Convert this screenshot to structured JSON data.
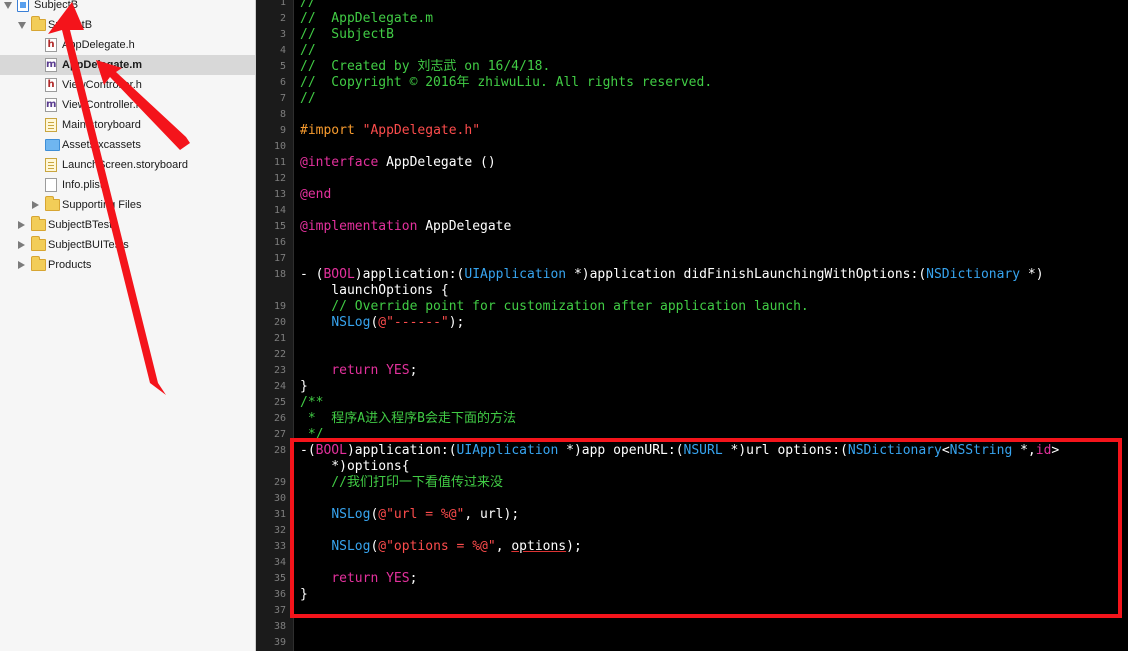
{
  "navigator": {
    "items": [
      {
        "label": "SubjectB",
        "kind": "project",
        "depth": 0,
        "disclosure": "open"
      },
      {
        "label": "SubjectB",
        "kind": "folder",
        "depth": 1,
        "disclosure": "open"
      },
      {
        "label": "AppDelegate.h",
        "kind": "h",
        "depth": 2,
        "disclosure": "none"
      },
      {
        "label": "AppDelegate.m",
        "kind": "m",
        "depth": 2,
        "disclosure": "none",
        "selected": true
      },
      {
        "label": "ViewController.h",
        "kind": "h",
        "depth": 2,
        "disclosure": "none"
      },
      {
        "label": "ViewController.m",
        "kind": "m",
        "depth": 2,
        "disclosure": "none"
      },
      {
        "label": "Main.storyboard",
        "kind": "storyboard",
        "depth": 2,
        "disclosure": "none"
      },
      {
        "label": "Assets.xcassets",
        "kind": "assets",
        "depth": 2,
        "disclosure": "none"
      },
      {
        "label": "LaunchScreen.storyboard",
        "kind": "storyboard",
        "depth": 2,
        "disclosure": "none"
      },
      {
        "label": "Info.plist",
        "kind": "plist",
        "depth": 2,
        "disclosure": "none"
      },
      {
        "label": "Supporting Files",
        "kind": "folder",
        "depth": 2,
        "disclosure": "closed"
      },
      {
        "label": "SubjectBTests",
        "kind": "folder",
        "depth": 1,
        "disclosure": "closed"
      },
      {
        "label": "SubjectBUITests",
        "kind": "folder",
        "depth": 1,
        "disclosure": "closed"
      },
      {
        "label": "Products",
        "kind": "folder",
        "depth": 1,
        "disclosure": "closed"
      }
    ]
  },
  "editor": {
    "lines": [
      {
        "n": "1",
        "tokens": [
          [
            "//",
            "cm"
          ]
        ]
      },
      {
        "n": "2",
        "tokens": [
          [
            "//  AppDelegate.m",
            "cm"
          ]
        ]
      },
      {
        "n": "3",
        "tokens": [
          [
            "//  SubjectB",
            "cm"
          ]
        ]
      },
      {
        "n": "4",
        "tokens": [
          [
            "//",
            "cm"
          ]
        ]
      },
      {
        "n": "5",
        "tokens": [
          [
            "//  Created by 刘志武 on 16/4/18.",
            "cm"
          ]
        ]
      },
      {
        "n": "6",
        "tokens": [
          [
            "//  Copyright © 2016年 zhiwuLiu. All rights reserved.",
            "cm"
          ]
        ]
      },
      {
        "n": "7",
        "tokens": [
          [
            "//",
            "cm"
          ]
        ]
      },
      {
        "n": "8",
        "tokens": []
      },
      {
        "n": "9",
        "tokens": [
          [
            "#import ",
            "pp"
          ],
          [
            "\"AppDelegate.h\"",
            "str"
          ]
        ]
      },
      {
        "n": "10",
        "tokens": []
      },
      {
        "n": "11",
        "tokens": [
          [
            "@interface",
            "kw"
          ],
          [
            " AppDelegate ()",
            "df"
          ]
        ]
      },
      {
        "n": "12",
        "tokens": []
      },
      {
        "n": "13",
        "tokens": [
          [
            "@end",
            "kw"
          ]
        ]
      },
      {
        "n": "14",
        "tokens": []
      },
      {
        "n": "15",
        "tokens": [
          [
            "@implementation",
            "kw"
          ],
          [
            " AppDelegate",
            "df"
          ]
        ]
      },
      {
        "n": "16",
        "tokens": []
      },
      {
        "n": "17",
        "tokens": []
      },
      {
        "n": "18",
        "tokens": [
          [
            "- (",
            "df"
          ],
          [
            "BOOL",
            "kw"
          ],
          [
            ")application:(",
            "df"
          ],
          [
            "UIApplication",
            "ty"
          ],
          [
            " *)application didFinishLaunchingWithOptions:(",
            "df"
          ],
          [
            "NSDictionary",
            "ty"
          ],
          [
            " *)",
            "df"
          ]
        ]
      },
      {
        "n": "",
        "tokens": [
          [
            "    launchOptions {",
            "df"
          ]
        ]
      },
      {
        "n": "19",
        "tokens": [
          [
            "    // Override point for customization after application launch.",
            "cm"
          ]
        ]
      },
      {
        "n": "20",
        "tokens": [
          [
            "    ",
            "df"
          ],
          [
            "NSLog",
            "ty"
          ],
          [
            "(",
            "df"
          ],
          [
            "@\"------\"",
            "str"
          ],
          [
            ");",
            "df"
          ]
        ]
      },
      {
        "n": "21",
        "tokens": []
      },
      {
        "n": "22",
        "tokens": []
      },
      {
        "n": "23",
        "tokens": [
          [
            "    ",
            "df"
          ],
          [
            "return",
            "kw"
          ],
          [
            " ",
            "df"
          ],
          [
            "YES",
            "kw"
          ],
          [
            ";",
            "df"
          ]
        ]
      },
      {
        "n": "24",
        "tokens": [
          [
            "}",
            "df"
          ]
        ]
      },
      {
        "n": "25",
        "tokens": [
          [
            "/**",
            "cm"
          ]
        ]
      },
      {
        "n": "26",
        "tokens": [
          [
            " *  程序A进入程序B会走下面的方法",
            "cm"
          ]
        ]
      },
      {
        "n": "27",
        "tokens": [
          [
            " */",
            "cm"
          ]
        ]
      },
      {
        "n": "28",
        "tokens": [
          [
            "-(",
            "df"
          ],
          [
            "BOOL",
            "kw"
          ],
          [
            ")application:(",
            "df"
          ],
          [
            "UIApplication",
            "ty"
          ],
          [
            " *)app openURL:(",
            "df"
          ],
          [
            "NSURL",
            "ty"
          ],
          [
            " *)url options:(",
            "df"
          ],
          [
            "NSDictionary",
            "ty"
          ],
          [
            "<",
            "df"
          ],
          [
            "NSString",
            "ty"
          ],
          [
            " *,",
            "df"
          ],
          [
            "id",
            "kw"
          ],
          [
            ">",
            "df"
          ]
        ]
      },
      {
        "n": "",
        "tokens": [
          [
            "    *)options{",
            "df"
          ]
        ]
      },
      {
        "n": "29",
        "tokens": [
          [
            "    //我们打印一下看值传过来没",
            "cm"
          ]
        ]
      },
      {
        "n": "30",
        "tokens": []
      },
      {
        "n": "31",
        "tokens": [
          [
            "    ",
            "df"
          ],
          [
            "NSLog",
            "ty"
          ],
          [
            "(",
            "df"
          ],
          [
            "@\"url = %@\"",
            "str"
          ],
          [
            ", url);",
            "df"
          ]
        ]
      },
      {
        "n": "32",
        "tokens": []
      },
      {
        "n": "33",
        "tokens": [
          [
            "    ",
            "df"
          ],
          [
            "NSLog",
            "ty"
          ],
          [
            "(",
            "df"
          ],
          [
            "@\"options = %@\"",
            "str"
          ],
          [
            ", ",
            "df"
          ],
          [
            "options",
            "ul"
          ],
          [
            ");",
            "df"
          ]
        ]
      },
      {
        "n": "34",
        "tokens": []
      },
      {
        "n": "35",
        "tokens": [
          [
            "    ",
            "df"
          ],
          [
            "return",
            "kw"
          ],
          [
            " ",
            "df"
          ],
          [
            "YES",
            "kw"
          ],
          [
            ";",
            "df"
          ]
        ]
      },
      {
        "n": "36",
        "tokens": [
          [
            "}",
            "df"
          ]
        ]
      },
      {
        "n": "37",
        "tokens": []
      },
      {
        "n": "38",
        "tokens": []
      },
      {
        "n": "39",
        "tokens": []
      }
    ]
  },
  "colors": {
    "comment": "#41cc45",
    "keyword": "#e4319d",
    "string": "#fc4c4c",
    "type": "#37a4ef",
    "preprocessor": "#f79b2e",
    "annotation": "#f4141b"
  }
}
